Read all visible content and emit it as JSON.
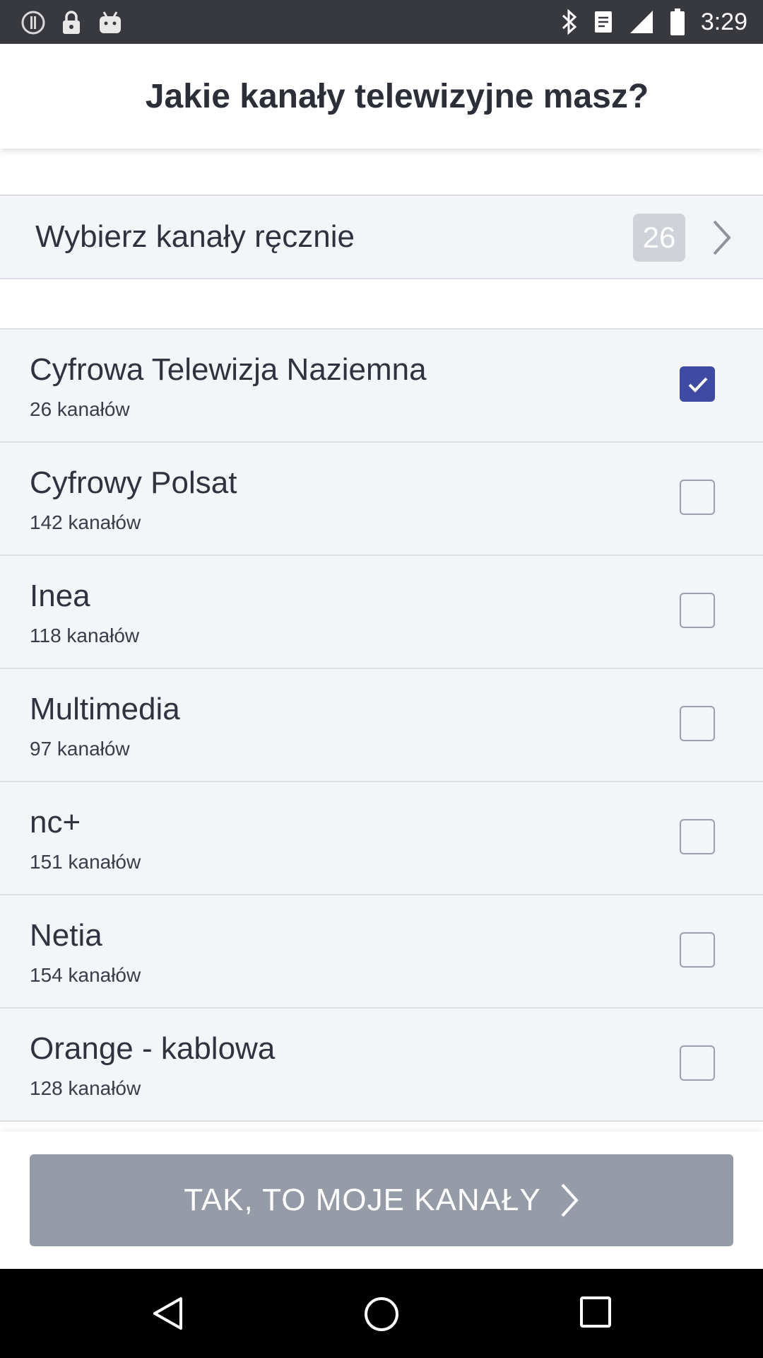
{
  "status_bar": {
    "time": "3:29",
    "left_icons": [
      "alert-circle-icon",
      "lock-icon",
      "android-icon"
    ],
    "right_icons": [
      "bluetooth-icon",
      "clipboard-icon",
      "signal-icon",
      "battery-icon"
    ]
  },
  "header": {
    "title": "Jakie kanały telewizyjne masz?"
  },
  "manual_select": {
    "label": "Wybierz kanały ręcznie",
    "count": "26",
    "chevron_icon": "chevron-right-icon"
  },
  "providers": [
    {
      "name": "Cyfrowa Telewizja Naziemna",
      "count": "26 kanałów",
      "checked": true
    },
    {
      "name": "Cyfrowy Polsat",
      "count": "142 kanałów",
      "checked": false
    },
    {
      "name": "Inea",
      "count": "118 kanałów",
      "checked": false
    },
    {
      "name": "Multimedia",
      "count": "97 kanałów",
      "checked": false
    },
    {
      "name": "nc+",
      "count": "151 kanałów",
      "checked": false
    },
    {
      "name": "Netia",
      "count": "154 kanałów",
      "checked": false
    },
    {
      "name": "Orange - kablowa",
      "count": "128 kanałów",
      "checked": false
    }
  ],
  "confirm_button": {
    "label": "TAK, TO MOJE KANAŁY",
    "icon": "chevron-right-icon"
  },
  "nav_bar": {
    "buttons": [
      "back-icon",
      "home-icon",
      "recents-icon"
    ]
  },
  "colors": {
    "status_bar": "#37393f",
    "row_background": "#f4f5f8",
    "checkbox_checked": "#3f4aa3",
    "button_disabled": "#969ca7",
    "badge": "#cfd2d8"
  }
}
